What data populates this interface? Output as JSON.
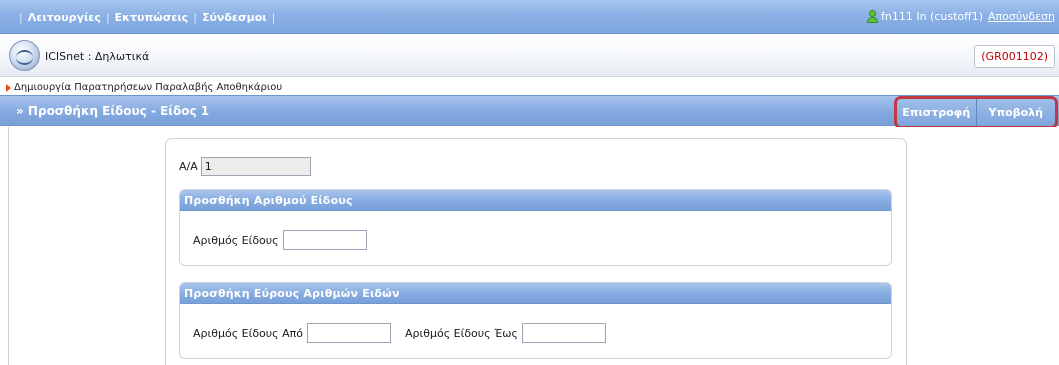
{
  "topbar": {
    "menu": [
      "Λειτουργίες",
      "Εκτυπώσεις",
      "Σύνδεσμοι"
    ],
    "user": "fn111 In (custoff1)",
    "logout": "Αποσύνδεση"
  },
  "app": {
    "title": "ICISnet : Δηλωτικά",
    "code": "(GR001102)"
  },
  "breadcrumb": {
    "text": "Δημιουργία Παρατηρήσεων Παραλαβής Αποθηκάριου"
  },
  "titlebar": {
    "title": "» Προσθήκη Είδους - Είδος 1",
    "back": "Επιστροφή",
    "submit": "Υποβολή"
  },
  "form": {
    "aa_label": "Α/Α",
    "aa_value": "1",
    "section1": {
      "header": "Προσθήκη Αριθμού Είδους",
      "item_label": "Αριθμός Είδους",
      "item_value": ""
    },
    "section2": {
      "header": "Προσθήκη Εύρους Αριθμών Ειδών",
      "from_label": "Αριθμός Είδους Από",
      "from_value": "",
      "to_label": "Αριθμός Είδους Έως",
      "to_value": ""
    }
  },
  "colors": {
    "accent_blue": "#86abe1",
    "code_red": "#c00000",
    "highlight_red": "#c0393f",
    "user_green": "#5cc43c"
  }
}
